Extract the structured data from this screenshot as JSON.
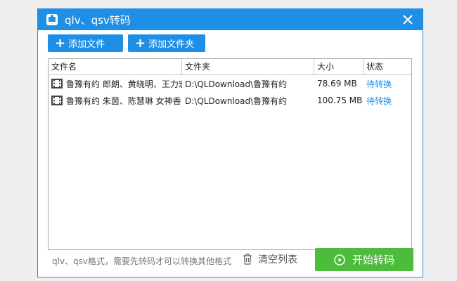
{
  "window": {
    "title": "qlv、qsv转码"
  },
  "toolbar": {
    "add_file_label": "添加文件",
    "add_folder_label": "添加文件夹"
  },
  "table": {
    "headers": [
      "文件名",
      "文件夹",
      "大小",
      "状态"
    ],
    "rows": [
      {
        "name": "鲁豫有约 郎朗、黄晓明、王力宏",
        "folder": "D:\\QLDownload\\鲁豫有约",
        "size": "78.69 MB",
        "status": "待转换"
      },
      {
        "name": "鲁豫有约 朱茵、陈慧琳 女神香",
        "folder": "D:\\QLDownload\\鲁豫有约",
        "size": "100.75 MB",
        "status": "待转换"
      }
    ]
  },
  "footer": {
    "hint": "qlv、qsv格式，需要先转码才可以转换其他格式",
    "clear_label": "清空列表",
    "start_label": "开始转码"
  },
  "colors": {
    "accent": "#1f8fe6",
    "start": "#4dbb3c"
  }
}
